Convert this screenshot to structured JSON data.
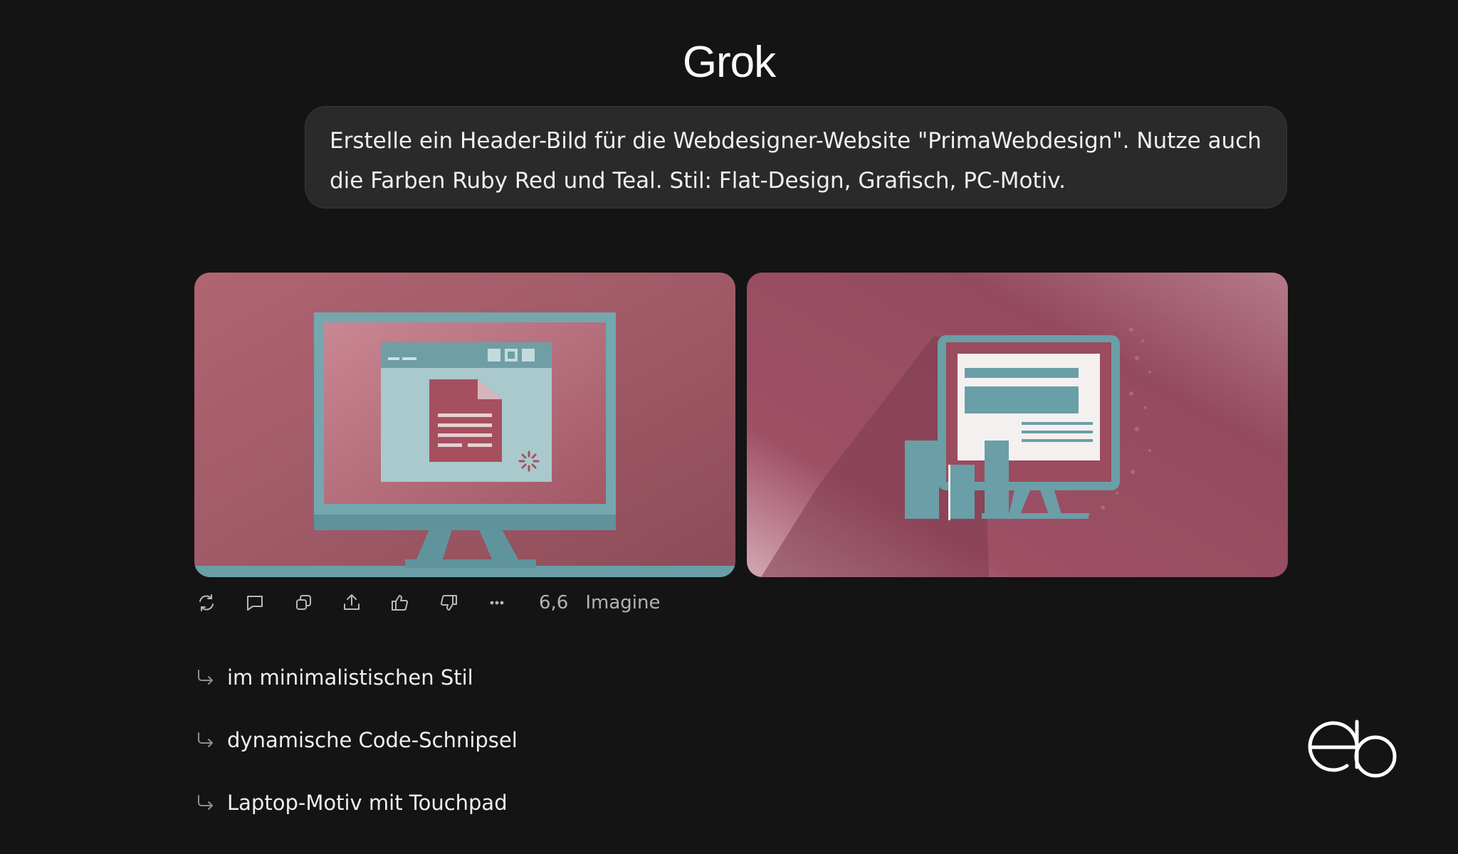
{
  "app": {
    "title": "Grok"
  },
  "prompt": {
    "text": "Erstelle ein Header-Bild für die Webdesigner-Website \"PrimaWebdesign\". Nutze auch die Farben Ruby Red und Teal. Stil: Flat-Design, Grafisch, PC-Motiv."
  },
  "colors": {
    "ruby": "#9b4c5e",
    "teal": "#6a9fa7",
    "background": "#141414"
  },
  "images": [
    {
      "alt_icon": "monitor-browser-illustration"
    },
    {
      "alt_icon": "monitor-website-illustration"
    }
  ],
  "actions": {
    "icons": [
      "regenerate-icon",
      "comment-icon",
      "copy-icon",
      "share-icon",
      "thumbs-up-icon",
      "thumbs-down-icon",
      "more-icon"
    ],
    "count": "6,6",
    "model": "Imagine"
  },
  "suggestions": [
    {
      "label": "im minimalistischen Stil"
    },
    {
      "label": "dynamische Code-Schnipsel"
    },
    {
      "label": "Laptop-Motiv mit Touchpad"
    }
  ],
  "logo": {
    "text": "eb"
  }
}
